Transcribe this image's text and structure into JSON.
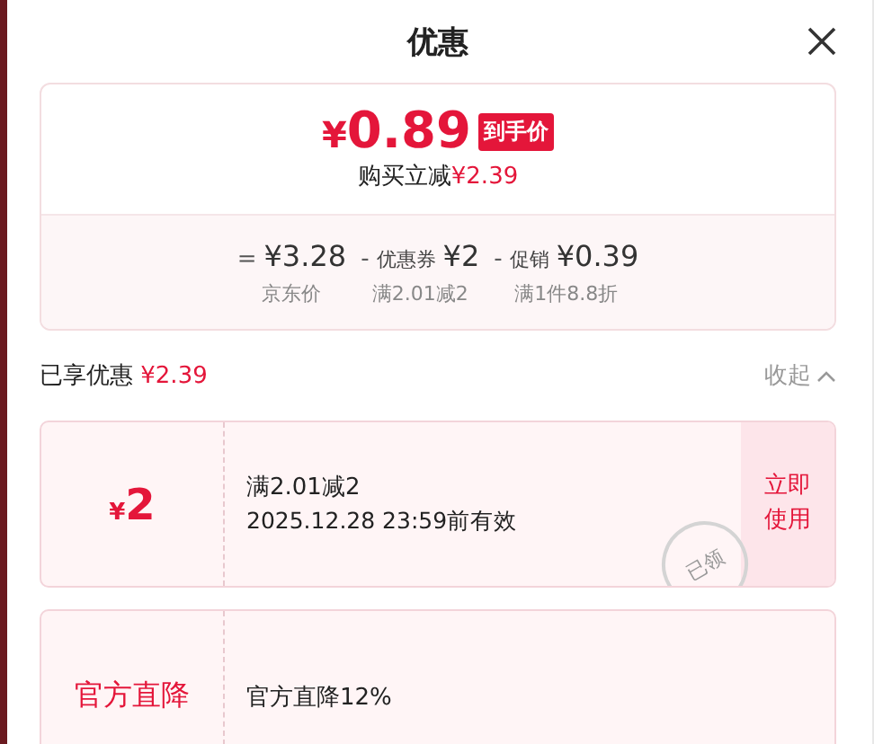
{
  "title": "优惠",
  "summary": {
    "price_symbol": "¥",
    "price": "0.89",
    "price_badge": "到手价",
    "saving_label": "购买立减",
    "saving": "¥2.39",
    "terms": [
      {
        "operator": "=",
        "value": "¥3.28",
        "caption": "京东价"
      },
      {
        "operator": "-",
        "label": "优惠券",
        "value": "¥2",
        "caption": "满2.01减2"
      },
      {
        "operator": "-",
        "label": "促销",
        "value": "¥0.39",
        "caption": "满1件8.8折"
      }
    ]
  },
  "enjoyed": {
    "label": "已享优惠",
    "amount": "¥2.39",
    "toggle": "收起",
    "expanded": true
  },
  "discounts": [
    {
      "kind": "coupon",
      "symbol": "¥",
      "amount": "2",
      "title": "满2.01减2",
      "validity": "2025.12.28 23:59前有效",
      "stamp": "已领",
      "action": "立即使用"
    },
    {
      "kind": "direct",
      "name": "官方直降",
      "title": "官方直降12%"
    }
  ]
}
